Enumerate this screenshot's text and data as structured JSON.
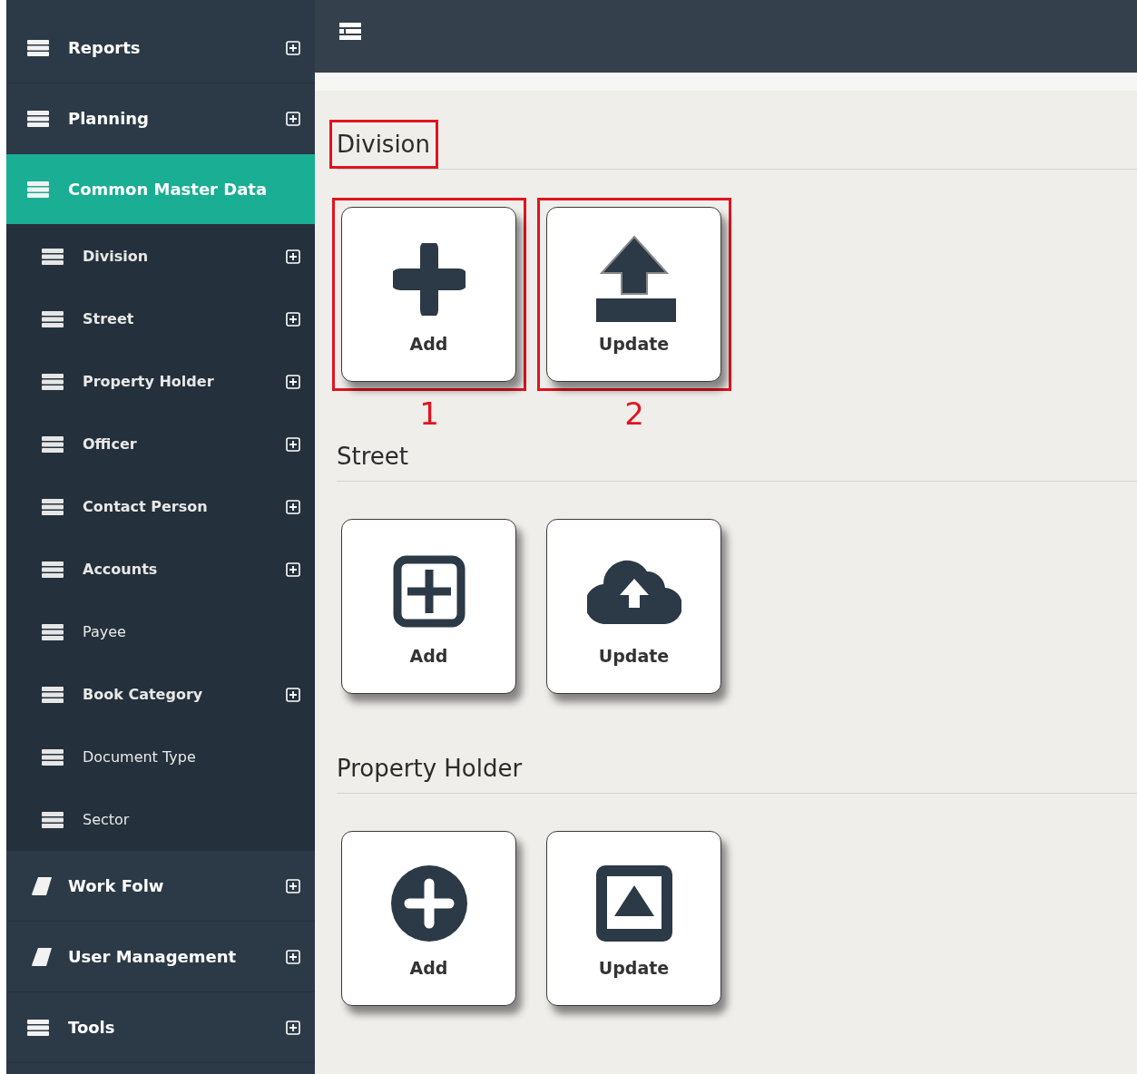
{
  "sidebar": {
    "items": [
      {
        "label": "Reports",
        "kind": "list",
        "expanded": false,
        "selected": false
      },
      {
        "label": "Planning",
        "kind": "list",
        "expanded": false,
        "selected": false
      },
      {
        "label": "Common Master Data",
        "kind": "list",
        "expanded": true,
        "selected": true,
        "children": [
          {
            "label": "Division",
            "kind": "group"
          },
          {
            "label": "Street",
            "kind": "group"
          },
          {
            "label": "Property Holder",
            "kind": "group"
          },
          {
            "label": "Officer",
            "kind": "group"
          },
          {
            "label": "Contact Person",
            "kind": "group"
          },
          {
            "label": "Accounts",
            "kind": "group"
          },
          {
            "label": "Payee",
            "kind": "leaf"
          },
          {
            "label": "Book Category",
            "kind": "group"
          },
          {
            "label": "Document Type",
            "kind": "leaf"
          },
          {
            "label": "Sector",
            "kind": "leaf"
          }
        ]
      },
      {
        "label": "Work Folw",
        "kind": "book",
        "expanded": false,
        "selected": false
      },
      {
        "label": "User Management",
        "kind": "book",
        "expanded": false,
        "selected": false
      },
      {
        "label": "Tools",
        "kind": "list",
        "expanded": false,
        "selected": false
      }
    ]
  },
  "sections": [
    {
      "title": "Division",
      "highlighted": true,
      "tiles": [
        {
          "label": "Add",
          "kind": "plus",
          "highlighted": true,
          "annotation": "1"
        },
        {
          "label": "Update",
          "kind": "upload",
          "highlighted": true,
          "annotation": "2"
        }
      ]
    },
    {
      "title": "Street",
      "highlighted": false,
      "tiles": [
        {
          "label": "Add",
          "kind": "square-plus",
          "highlighted": false
        },
        {
          "label": "Update",
          "kind": "cloud-upload",
          "highlighted": false
        }
      ]
    },
    {
      "title": "Property Holder",
      "highlighted": false,
      "tiles": [
        {
          "label": "Add",
          "kind": "circle-plus",
          "highlighted": false
        },
        {
          "label": "Update",
          "kind": "square-triangle",
          "highlighted": false
        }
      ]
    }
  ]
}
